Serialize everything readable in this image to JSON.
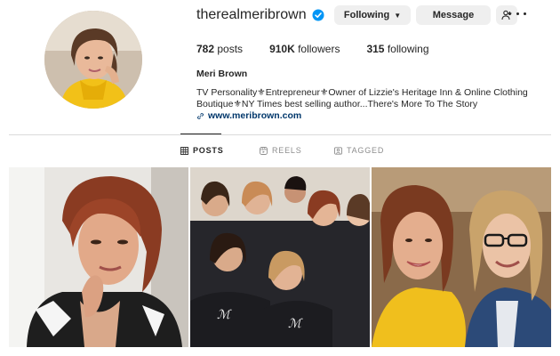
{
  "profile": {
    "username": "therealmeribrown",
    "verified_icon": "verified-badge-icon",
    "full_name": "Meri Brown",
    "bio_line1": "TV Personality⚜Entrepreneur⚜Owner of Lizzie's Heritage Inn & Online Clothing",
    "bio_line2": "Boutique⚜NY Times best selling author...There's More To The Story",
    "website": "www.meribrown.com"
  },
  "buttons": {
    "following": "Following",
    "message": "Message"
  },
  "stats": {
    "posts_count": "782",
    "posts_label": "posts",
    "followers_count": "910K",
    "followers_label": "followers",
    "following_count": "315",
    "following_label": "following"
  },
  "tabs": [
    {
      "label": "POSTS",
      "icon": "grid-icon",
      "active": true
    },
    {
      "label": "REELS",
      "icon": "reels-icon",
      "active": false
    },
    {
      "label": "TAGGED",
      "icon": "tagged-icon",
      "active": false
    }
  ],
  "colors": {
    "verified_blue": "#0095f6",
    "link_color": "#00376b",
    "button_bg": "#efefef"
  }
}
